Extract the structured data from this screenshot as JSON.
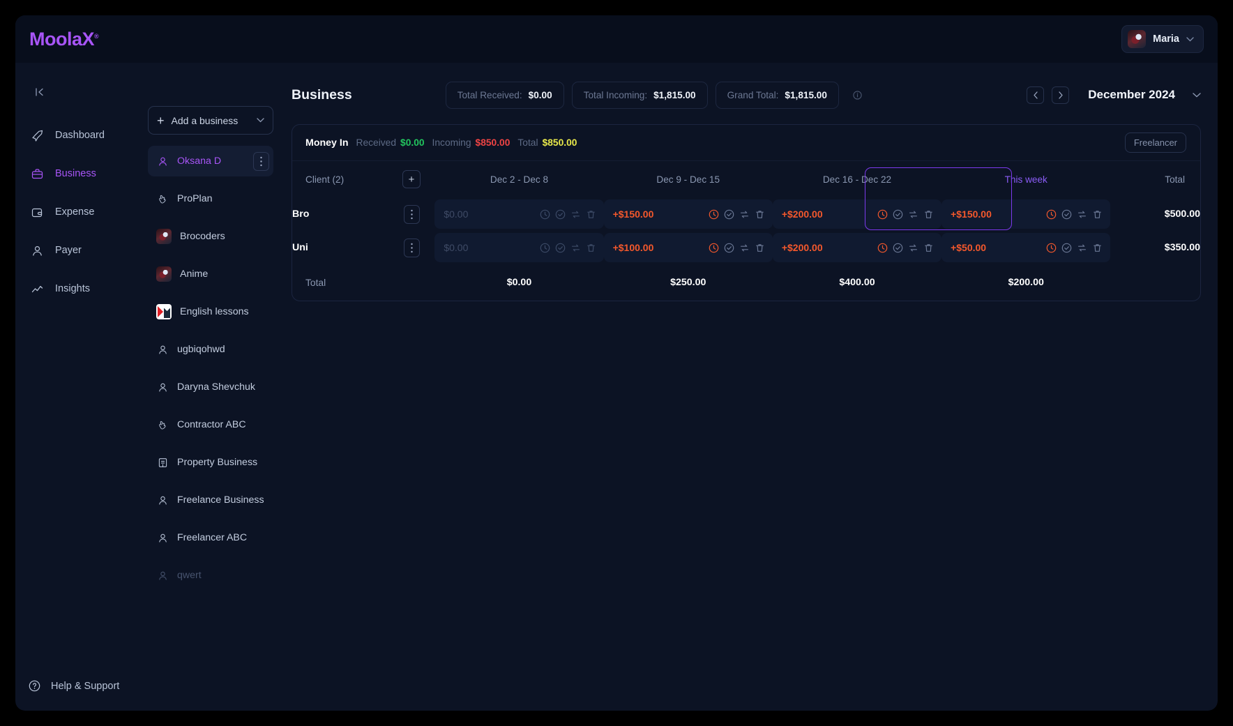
{
  "brand": {
    "name": "MoolaX",
    "tm": "®",
    "color": "#a855f7"
  },
  "topbar": {
    "user_name": "Maria",
    "caret": "⌄"
  },
  "nav": {
    "collapse_label": "|<",
    "items": [
      {
        "label": "Dashboard",
        "icon": "rocket-icon",
        "active": false
      },
      {
        "label": "Business",
        "icon": "briefcase-icon",
        "active": true
      },
      {
        "label": "Expense",
        "icon": "wallet-icon",
        "active": false
      },
      {
        "label": "Payer",
        "icon": "user-icon",
        "active": false
      },
      {
        "label": "Insights",
        "icon": "chart-line-icon",
        "active": false
      }
    ],
    "help": {
      "label": "Help & Support",
      "icon": "question-circle-icon"
    }
  },
  "business_panel": {
    "add_label": "Add a business",
    "items": [
      {
        "label": "Oksana D",
        "icon": "user-icon",
        "active": true,
        "kebab": true
      },
      {
        "label": "ProPlan",
        "icon": "hand-icon",
        "active": false
      },
      {
        "label": "Brocoders",
        "icon": "avatar-image",
        "active": false
      },
      {
        "label": "Anime",
        "icon": "avatar-image",
        "active": false
      },
      {
        "label": "English lessons",
        "icon": "k-logo",
        "active": false
      },
      {
        "label": "ugbiqohwd",
        "icon": "user-icon",
        "active": false
      },
      {
        "label": "Daryna Shevchuk",
        "icon": "user-icon",
        "active": false
      },
      {
        "label": "Contractor ABC",
        "icon": "hand-icon",
        "active": false
      },
      {
        "label": "Property Business",
        "icon": "building-icon",
        "active": false
      },
      {
        "label": "Freelance Business",
        "icon": "user-icon",
        "active": false
      },
      {
        "label": "Freelancer ABC",
        "icon": "user-icon",
        "active": false
      },
      {
        "label": "qwert",
        "icon": "user-icon",
        "active": false,
        "dim": true
      }
    ]
  },
  "header": {
    "page_title": "Business",
    "totals": [
      {
        "label": "Total Received:",
        "value": "$0.00"
      },
      {
        "label": "Total Incoming:",
        "value": "$1,815.00"
      },
      {
        "label": "Grand Total:",
        "value": "$1,815.00"
      }
    ],
    "info_icon": "info-icon",
    "prev_label": "‹",
    "next_label": "›",
    "month": "December 2024",
    "month_chevron": "⌄"
  },
  "money_in": {
    "title": "Money In",
    "received_label": "Received",
    "received_value": "$0.00",
    "incoming_label": "Incoming",
    "incoming_value": "$850.00",
    "total_label": "Total",
    "total_value": "$850.00",
    "tag": "Freelancer"
  },
  "table": {
    "client_header": "Client (2)",
    "add_client_label": "+",
    "columns": [
      {
        "label": "Dec 2 - Dec 8",
        "current": false
      },
      {
        "label": "Dec 9 - Dec 15",
        "current": false
      },
      {
        "label": "Dec 16 - Dec 22",
        "current": false
      },
      {
        "label": "This week",
        "current": true
      }
    ],
    "total_header": "Total",
    "rows": [
      {
        "name": "Bro",
        "cells": [
          {
            "amount": "$0.00",
            "state": "zero"
          },
          {
            "amount": "+$150.00",
            "state": "pos"
          },
          {
            "amount": "+$200.00",
            "state": "pos"
          },
          {
            "amount": "+$150.00",
            "state": "pos"
          }
        ],
        "total": "$500.00"
      },
      {
        "name": "Uni",
        "cells": [
          {
            "amount": "$0.00",
            "state": "zero"
          },
          {
            "amount": "+$100.00",
            "state": "pos"
          },
          {
            "amount": "+$200.00",
            "state": "pos"
          },
          {
            "amount": "+$50.00",
            "state": "pos"
          }
        ],
        "total": "$350.00"
      }
    ],
    "footer": {
      "label": "Total",
      "values": [
        "$0.00",
        "$250.00",
        "$400.00",
        "$200.00"
      ]
    },
    "row_actions": [
      "clock-icon",
      "check-circle-icon",
      "repeat-icon",
      "trash-icon"
    ]
  },
  "colors": {
    "accent": "#a855f7",
    "current_week": "#8b5cf6",
    "positive": "#f4582c",
    "green": "#22c55e",
    "red": "#ef4444",
    "yellow": "#e8e84a"
  }
}
